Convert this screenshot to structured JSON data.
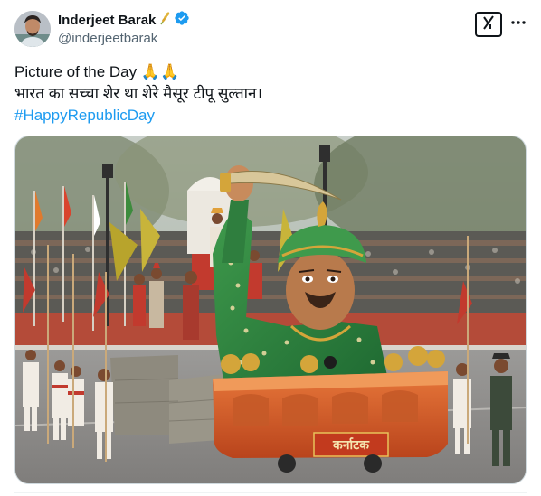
{
  "author": {
    "name": "Inderjeet Barak",
    "handle": "@inderjeetbarak",
    "name_emoji_icon": "wheat-sheaf-icon",
    "verified_icon": "verified-badge-icon",
    "verified_color": "#1d9bf0"
  },
  "actions": {
    "grok_icon": "grok-icon",
    "more_icon": "more-options-icon"
  },
  "post": {
    "line1": "Picture of the Day 🙏🙏",
    "line2": "भारत का सच्चा शेर था शेरे मैसूर टीपू सुल्तान।",
    "hashtag": "#HappyRepublicDay",
    "hashtag_color": "#1d9bf0"
  },
  "media": {
    "float_sign": "कर्नाटक"
  }
}
